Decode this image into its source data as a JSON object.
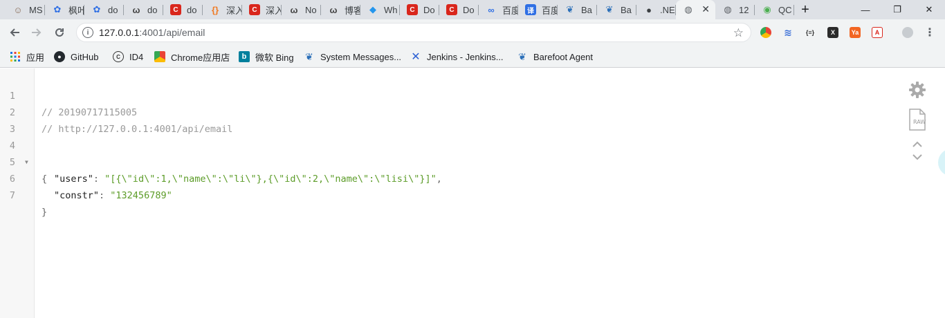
{
  "tabs": [
    {
      "title": "MS",
      "icon": "avatar-icon",
      "color": "#8a6d5a"
    },
    {
      "title": "枫叶",
      "icon": "baidu-paw-icon",
      "color": "#2f6fe4"
    },
    {
      "title": "do",
      "icon": "baidu-paw-icon",
      "color": "#2f6fe4"
    },
    {
      "title": "do",
      "icon": "yuque-icon",
      "color": "#444444"
    },
    {
      "title": "do",
      "icon": "csdn-icon",
      "color": "#d9261c"
    },
    {
      "title": "深入",
      "icon": "code-brackets-icon",
      "color": "#f07a23"
    },
    {
      "title": "深入",
      "icon": "csdn-icon",
      "color": "#d9261c"
    },
    {
      "title": "No",
      "icon": "yuque-icon",
      "color": "#444444"
    },
    {
      "title": "博客",
      "icon": "yuque-icon",
      "color": "#444444"
    },
    {
      "title": "Wh",
      "icon": "docker-whale-icon",
      "color": "#2496ed"
    },
    {
      "title": "Do",
      "icon": "csdn-icon",
      "color": "#d9261c"
    },
    {
      "title": "Do",
      "icon": "csdn-icon",
      "color": "#d9261c"
    },
    {
      "title": "百度",
      "icon": "baidu-cloud-icon",
      "color": "#2f6fe4"
    },
    {
      "title": "百度",
      "icon": "translate-icon",
      "color": "#2f6fe4"
    },
    {
      "title": "Ba",
      "icon": "barefoot-icon",
      "color": "#2b6fb8"
    },
    {
      "title": "Ba",
      "icon": "barefoot-icon",
      "color": "#2b6fb8"
    },
    {
      "title": ".NE",
      "icon": "dotnet-icon",
      "color": "#3c4043"
    },
    {
      "title": "",
      "icon": "globe-icon",
      "color": "#5f6368",
      "active": true
    },
    {
      "title": "12",
      "icon": "globe-icon",
      "color": "#5f6368"
    },
    {
      "title": "QC",
      "icon": "chrome-icon",
      "color": "#4caf50"
    }
  ],
  "address": {
    "host": "127.0.0.1",
    "path": ":4001/api/email"
  },
  "bookmarks": [
    {
      "label": "应用",
      "icon": "apps-grid-icon"
    },
    {
      "label": "GitHub",
      "icon": "github-icon"
    },
    {
      "label": "ID4",
      "icon": "id4-icon"
    },
    {
      "label": "Chrome应用店",
      "icon": "chrome-store-icon"
    },
    {
      "label": "微软 Bing",
      "icon": "bing-icon"
    },
    {
      "label": "System Messages...",
      "icon": "barefoot-icon"
    },
    {
      "label": "Jenkins - Jenkins...",
      "icon": "confluence-icon"
    },
    {
      "label": "Barefoot Agent",
      "icon": "barefoot-icon"
    }
  ],
  "viewer": {
    "line_numbers": [
      "1",
      "2",
      "3",
      "4",
      "5",
      "6",
      "7"
    ],
    "comment_timestamp": "// 20190717115005",
    "comment_url": "// http://127.0.0.1:4001/api/email",
    "open_brace": "{",
    "close_brace": "}",
    "users_key": "\"users\"",
    "users_value": "\"[{\\\"id\\\":1,\\\"name\\\":\\\"li\\\"},{\\\"id\\\":2,\\\"name\\\":\\\"lisi\\\"}]\"",
    "constr_key": "\"constr\"",
    "constr_value": "\"132456789\"",
    "colon": ": ",
    "comma": ","
  },
  "side_tools": {
    "raw_label": "RAW"
  },
  "colors": {
    "string": "#5c9c28",
    "comment": "#999999",
    "tabstrip": "#dee1e6",
    "toolbar": "#f1f3f4"
  }
}
